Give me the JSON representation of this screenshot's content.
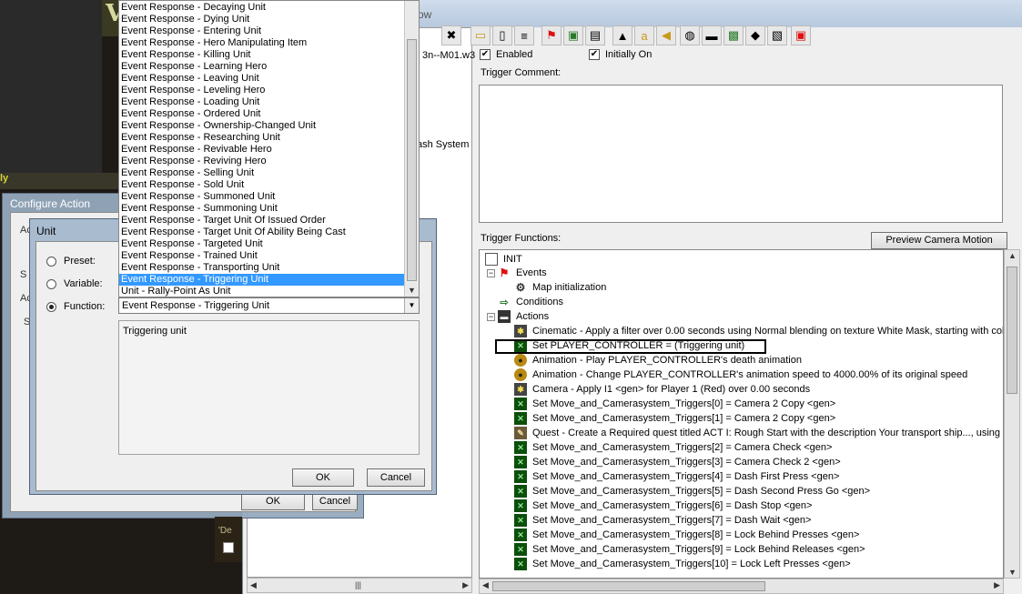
{
  "editor": {
    "title_fragment": "ow",
    "left_tree_text1": "3n--M01.w3",
    "left_tree_text2": "ash System",
    "enabled_label": "Enabled",
    "initially_on_label": "Initially On",
    "trigger_comment_label": "Trigger Comment:",
    "trigger_functions_label": "Trigger Functions:",
    "preview_button": "Preview Camera Motion"
  },
  "tree": {
    "root": "INIT",
    "events_label": "Events",
    "event_item": "Map initialization",
    "conditions_label": "Conditions",
    "actions_label": "Actions",
    "actions": [
      {
        "icon": "cam",
        "text": "Cinematic - Apply a filter over 0.00 seconds using Normal blending on texture White Mask, starting with color ("
      },
      {
        "icon": "x",
        "text": "Set PLAYER_CONTROLLER = (Triggering unit)"
      },
      {
        "icon": "anim",
        "text": "Animation - Play PLAYER_CONTROLLER's death animation"
      },
      {
        "icon": "anim",
        "text": "Animation - Change PLAYER_CONTROLLER's animation speed to 4000.00% of its original speed"
      },
      {
        "icon": "cam",
        "text": "Camera - Apply I1 <gen> for Player 1 (Red) over 0.00 seconds"
      },
      {
        "icon": "x",
        "text": "Set Move_and_Camerasystem_Triggers[0] = Camera 2 Copy <gen>"
      },
      {
        "icon": "x",
        "text": "Set Move_and_Camerasystem_Triggers[1] = Camera 2 Copy <gen>"
      },
      {
        "icon": "quest",
        "text": "Quest - Create a Required quest titled ACT I: Rough Start with the description Your transport ship..., using icon"
      },
      {
        "icon": "x",
        "text": "Set Move_and_Camerasystem_Triggers[2] = Camera Check <gen>"
      },
      {
        "icon": "x",
        "text": "Set Move_and_Camerasystem_Triggers[3] = Camera Check 2 <gen>"
      },
      {
        "icon": "x",
        "text": "Set Move_and_Camerasystem_Triggers[4] = Dash First Press <gen>"
      },
      {
        "icon": "x",
        "text": "Set Move_and_Camerasystem_Triggers[5] = Dash Second Press Go <gen>"
      },
      {
        "icon": "x",
        "text": "Set Move_and_Camerasystem_Triggers[6] = Dash Stop <gen>"
      },
      {
        "icon": "x",
        "text": "Set Move_and_Camerasystem_Triggers[7] = Dash Wait <gen>"
      },
      {
        "icon": "x",
        "text": "Set Move_and_Camerasystem_Triggers[8] = Lock Behind Presses <gen>"
      },
      {
        "icon": "x",
        "text": "Set Move_and_Camerasystem_Triggers[9] = Lock Behind Releases <gen>"
      },
      {
        "icon": "x",
        "text": "Set Move_and_Camerasystem_Triggers[10] = Lock Left Presses <gen>"
      }
    ]
  },
  "configure_action": {
    "title": "Configure Action",
    "ok": "OK",
    "cancel": "Cancel",
    "frag_ac1": "Ac",
    "frag_s1": "S",
    "frag_ac2": "Ac",
    "frag_s2": "S"
  },
  "unit_dialog": {
    "title": "Unit",
    "preset": "Preset:",
    "variable": "Variable:",
    "function": "Function:",
    "selected": "Event Response - Triggering Unit",
    "description": "Triggering unit",
    "ok": "OK",
    "cancel": "Cancel"
  },
  "dropdown": {
    "items": [
      "Event Response - Decaying Unit",
      "Event Response - Dying Unit",
      "Event Response - Entering Unit",
      "Event Response - Hero Manipulating Item",
      "Event Response - Killing Unit",
      "Event Response - Learning Hero",
      "Event Response - Leaving Unit",
      "Event Response - Leveling Hero",
      "Event Response - Loading Unit",
      "Event Response - Ordered Unit",
      "Event Response - Ownership-Changed Unit",
      "Event Response - Researching Unit",
      "Event Response - Revivable Hero",
      "Event Response - Reviving Hero",
      "Event Response - Selling Unit",
      "Event Response - Sold Unit",
      "Event Response - Summoned Unit",
      "Event Response - Summoning Unit",
      "Event Response - Target Unit Of Issued Order",
      "Event Response - Target Unit Of Ability Being Cast",
      "Event Response - Targeted Unit",
      "Event Response - Trained Unit",
      "Event Response - Transporting Unit",
      "Event Response - Triggering Unit",
      "Unit - Rally-Point As Unit"
    ],
    "selected_index": 23
  },
  "bg_fragments": {
    "ly": "ly",
    "de": "'De",
    "v": "V"
  }
}
